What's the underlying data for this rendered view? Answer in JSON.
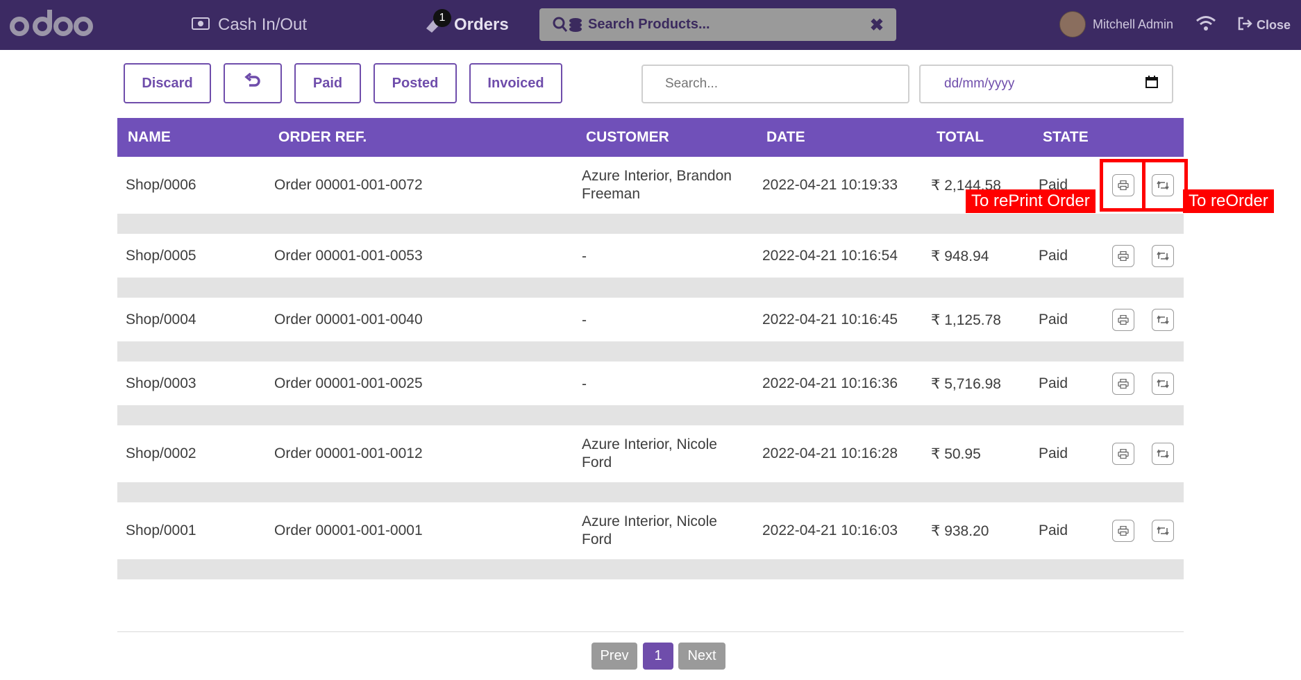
{
  "topbar": {
    "logo": "odoo",
    "cash_label": "Cash In/Out",
    "orders_label": "Orders",
    "orders_badge": "1",
    "product_search_placeholder": "Search Products...",
    "user_name": "Mitchell Admin",
    "close_label": "Close"
  },
  "toolbar": {
    "discard": "Discard",
    "paid": "Paid",
    "posted": "Posted",
    "invoiced": "Invoiced",
    "search_placeholder": "Search...",
    "date_placeholder": "dd/mm/yyyy"
  },
  "table": {
    "headers": [
      "NAME",
      "ORDER REF.",
      "CUSTOMER",
      "DATE",
      "TOTAL",
      "STATE"
    ],
    "rows": [
      {
        "name": "Shop/0006",
        "ref": "Order 00001-001-0072",
        "customer": "Azure Interior, Brandon Freeman",
        "date": "2022-04-21 10:19:33",
        "total": "₹ 2,144.58",
        "state": "Paid"
      },
      {
        "name": "Shop/0005",
        "ref": "Order 00001-001-0053",
        "customer": "-",
        "date": "2022-04-21 10:16:54",
        "total": "₹ 948.94",
        "state": "Paid"
      },
      {
        "name": "Shop/0004",
        "ref": "Order 00001-001-0040",
        "customer": "-",
        "date": "2022-04-21 10:16:45",
        "total": "₹ 1,125.78",
        "state": "Paid"
      },
      {
        "name": "Shop/0003",
        "ref": "Order 00001-001-0025",
        "customer": "-",
        "date": "2022-04-21 10:16:36",
        "total": "₹ 5,716.98",
        "state": "Paid"
      },
      {
        "name": "Shop/0002",
        "ref": "Order 00001-001-0012",
        "customer": "Azure Interior, Nicole Ford",
        "date": "2022-04-21 10:16:28",
        "total": "₹ 50.95",
        "state": "Paid"
      },
      {
        "name": "Shop/0001",
        "ref": "Order 00001-001-0001",
        "customer": "Azure Interior, Nicole Ford",
        "date": "2022-04-21 10:16:03",
        "total": "₹ 938.20",
        "state": "Paid"
      }
    ]
  },
  "annotations": {
    "reprint": "To rePrint Order",
    "reorder": "To reOrder"
  },
  "pagination": {
    "prev": "Prev",
    "current": "1",
    "next": "Next"
  },
  "colors": {
    "topbar": "#3c2a63",
    "accent": "#7050b9",
    "annotation": "#ff0000"
  }
}
